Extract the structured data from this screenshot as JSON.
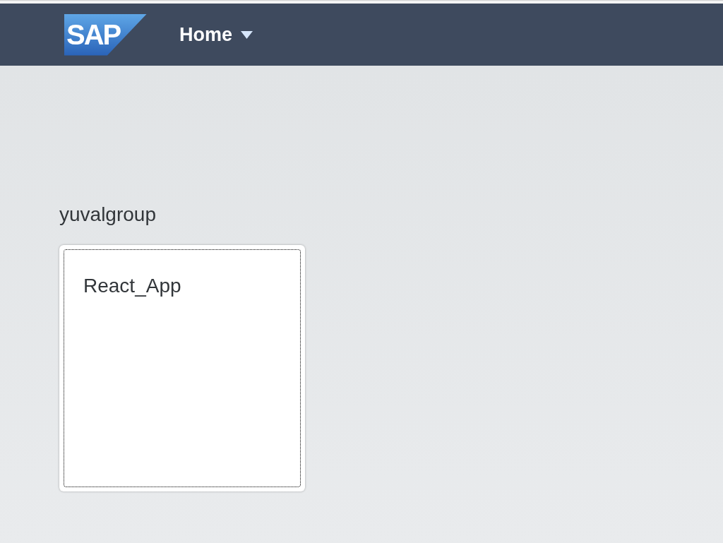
{
  "header": {
    "logo_text": "SAP",
    "title": "Home",
    "has_menu": true
  },
  "groups": [
    {
      "title": "yuvalgroup",
      "tiles": [
        {
          "title": "React_App",
          "focused": true
        }
      ]
    }
  ]
}
